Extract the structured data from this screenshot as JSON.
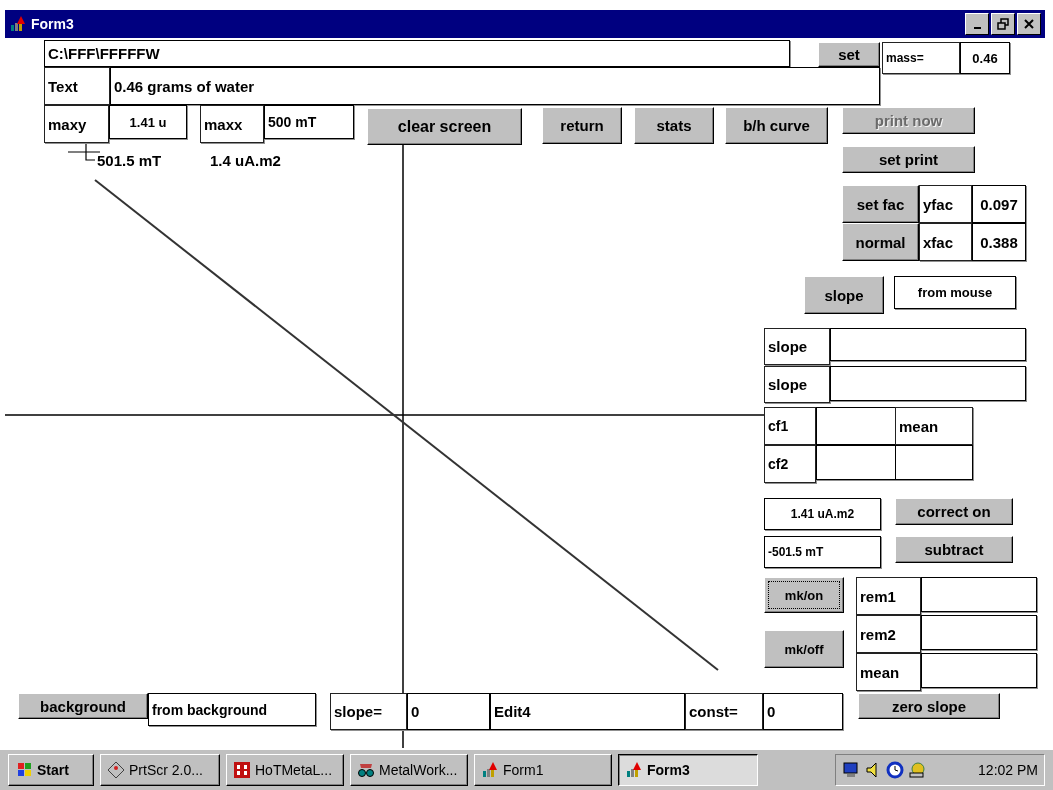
{
  "window": {
    "title": "Form3"
  },
  "controls": [
    {
      "kind": "field",
      "text": "C:\\FFF\\FFFFFW"
    },
    {
      "kind": "button",
      "text": "set"
    },
    {
      "kind": "label",
      "text": "mass="
    },
    {
      "kind": "field",
      "text": "0.46"
    },
    {
      "kind": "label",
      "text": "Text"
    },
    {
      "kind": "field",
      "text": "0.46 grams of water"
    },
    {
      "kind": "label",
      "text": "maxy"
    },
    {
      "kind": "field",
      "text": "1.41 u"
    },
    {
      "kind": "label",
      "text": "maxx"
    },
    {
      "kind": "field",
      "text": "500 mT"
    },
    {
      "kind": "button",
      "text": "clear screen"
    },
    {
      "kind": "button",
      "text": "return"
    },
    {
      "kind": "button",
      "text": "stats"
    },
    {
      "kind": "button",
      "text": "b/h curve"
    },
    {
      "kind": "button",
      "text": "print now",
      "disabled": true
    },
    {
      "kind": "button",
      "text": "set print"
    },
    {
      "kind": "button",
      "text": "set fac"
    },
    {
      "kind": "label",
      "text": "yfac"
    },
    {
      "kind": "field",
      "text": "0.097"
    },
    {
      "kind": "button",
      "text": "normal"
    },
    {
      "kind": "label",
      "text": "xfac"
    },
    {
      "kind": "field",
      "text": "0.388"
    },
    {
      "kind": "button",
      "text": "slope"
    },
    {
      "kind": "field",
      "text": "from mouse"
    },
    {
      "kind": "label",
      "text": "slope"
    },
    {
      "kind": "field"
    },
    {
      "kind": "label",
      "text": "slope"
    },
    {
      "kind": "field"
    },
    {
      "kind": "label",
      "text": "cf1"
    },
    {
      "kind": "field"
    },
    {
      "kind": "label",
      "text": "mean"
    },
    {
      "kind": "label",
      "text": "cf2"
    },
    {
      "kind": "field"
    },
    {
      "kind": "field"
    },
    {
      "kind": "field",
      "text": "1.41 uA.m2"
    },
    {
      "kind": "button",
      "text": "correct on"
    },
    {
      "kind": "field",
      "text": "-501.5 mT"
    },
    {
      "kind": "button",
      "text": "subtract"
    },
    {
      "kind": "button",
      "text": "mk/on",
      "focused": true
    },
    {
      "kind": "label",
      "text": "rem1"
    },
    {
      "kind": "field"
    },
    {
      "kind": "button",
      "text": "mk/off"
    },
    {
      "kind": "label",
      "text": "rem2"
    },
    {
      "kind": "field"
    },
    {
      "kind": "label",
      "text": "mean"
    },
    {
      "kind": "field"
    },
    {
      "kind": "button",
      "text": "background"
    },
    {
      "kind": "field",
      "text": "from background"
    },
    {
      "kind": "label",
      "text": "slope="
    },
    {
      "kind": "field",
      "text": "0"
    },
    {
      "kind": "field",
      "text": "Edit4"
    },
    {
      "kind": "label",
      "text": "const="
    },
    {
      "kind": "field",
      "text": "0"
    },
    {
      "kind": "button",
      "text": "zero slope"
    }
  ],
  "plot": {
    "readouts": [
      "501.5 mT",
      "1.4 uA.m2"
    ]
  },
  "taskbar": {
    "start": "Start",
    "tasks": [
      {
        "label": "PrtScr 2.0...",
        "selected": false
      },
      {
        "label": "HoTMetaL...",
        "selected": false
      },
      {
        "label": "MetalWork...",
        "selected": false
      },
      {
        "label": "Form1",
        "selected": false
      },
      {
        "label": "Form3",
        "selected": true
      }
    ],
    "clock": "12:02 PM"
  }
}
